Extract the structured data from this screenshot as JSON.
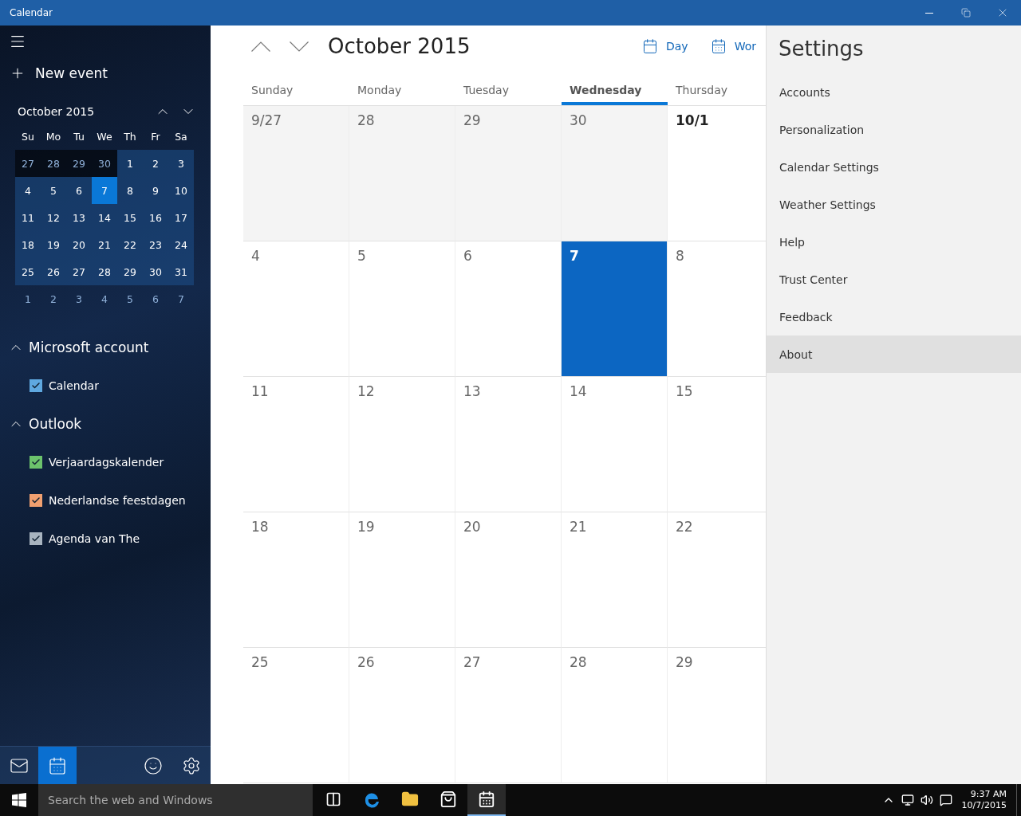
{
  "window": {
    "title": "Calendar"
  },
  "sidebar": {
    "new_event": "New event",
    "mini_calendar": {
      "title": "October 2015",
      "weekdays": [
        "Su",
        "Mo",
        "Tu",
        "We",
        "Th",
        "Fr",
        "Sa"
      ],
      "weeks": [
        [
          {
            "label": "27",
            "kind": "prev"
          },
          {
            "label": "28",
            "kind": "prev"
          },
          {
            "label": "29",
            "kind": "prev"
          },
          {
            "label": "30",
            "kind": "prev"
          },
          {
            "label": "1",
            "kind": "day"
          },
          {
            "label": "2",
            "kind": "day"
          },
          {
            "label": "3",
            "kind": "day"
          }
        ],
        [
          {
            "label": "4",
            "kind": "day"
          },
          {
            "label": "5",
            "kind": "day"
          },
          {
            "label": "6",
            "kind": "day"
          },
          {
            "label": "7",
            "kind": "today"
          },
          {
            "label": "8",
            "kind": "day"
          },
          {
            "label": "9",
            "kind": "day"
          },
          {
            "label": "10",
            "kind": "day"
          }
        ],
        [
          {
            "label": "11",
            "kind": "day"
          },
          {
            "label": "12",
            "kind": "day"
          },
          {
            "label": "13",
            "kind": "day"
          },
          {
            "label": "14",
            "kind": "day"
          },
          {
            "label": "15",
            "kind": "day"
          },
          {
            "label": "16",
            "kind": "day"
          },
          {
            "label": "17",
            "kind": "day"
          }
        ],
        [
          {
            "label": "18",
            "kind": "day"
          },
          {
            "label": "19",
            "kind": "day"
          },
          {
            "label": "20",
            "kind": "day"
          },
          {
            "label": "21",
            "kind": "day"
          },
          {
            "label": "22",
            "kind": "day"
          },
          {
            "label": "23",
            "kind": "day"
          },
          {
            "label": "24",
            "kind": "day"
          }
        ],
        [
          {
            "label": "25",
            "kind": "day"
          },
          {
            "label": "26",
            "kind": "day"
          },
          {
            "label": "27",
            "kind": "day"
          },
          {
            "label": "28",
            "kind": "day"
          },
          {
            "label": "29",
            "kind": "day"
          },
          {
            "label": "30",
            "kind": "day"
          },
          {
            "label": "31",
            "kind": "day"
          }
        ],
        [
          {
            "label": "1",
            "kind": "next"
          },
          {
            "label": "2",
            "kind": "next"
          },
          {
            "label": "3",
            "kind": "next"
          },
          {
            "label": "4",
            "kind": "next"
          },
          {
            "label": "5",
            "kind": "next"
          },
          {
            "label": "6",
            "kind": "next"
          },
          {
            "label": "7",
            "kind": "next"
          }
        ]
      ]
    },
    "accounts": [
      {
        "name": "Microsoft account",
        "expanded": true,
        "calendars": [
          {
            "name": "Calendar",
            "checked": true,
            "color": "#5fa8e0"
          }
        ]
      },
      {
        "name": "Outlook",
        "expanded": true,
        "calendars": [
          {
            "name": "Verjaardagskalender",
            "checked": true,
            "color": "#6cc36c"
          },
          {
            "name": "Nederlandse feestdagen",
            "checked": true,
            "color": "#f0a070"
          },
          {
            "name": "Agenda van The",
            "checked": true,
            "color": "#a8b4c0"
          }
        ]
      }
    ],
    "bottom_nav": [
      {
        "kind": "mail",
        "selected": false
      },
      {
        "kind": "calendar",
        "selected": true
      },
      {
        "kind": "feedback",
        "selected": false
      },
      {
        "kind": "settings",
        "selected": false
      }
    ]
  },
  "main": {
    "title": "October 2015",
    "views": [
      "Day",
      "Wor"
    ],
    "weekdays": [
      {
        "label": "Sunday",
        "selected": false
      },
      {
        "label": "Monday",
        "selected": false
      },
      {
        "label": "Tuesday",
        "selected": false
      },
      {
        "label": "Wednesday",
        "selected": true
      },
      {
        "label": "Thursday",
        "selected": false
      }
    ],
    "weeks": [
      [
        {
          "label": "9/27",
          "kind": "prev"
        },
        {
          "label": "28",
          "kind": "prev"
        },
        {
          "label": "29",
          "kind": "prev"
        },
        {
          "label": "30",
          "kind": "prev"
        },
        {
          "label": "10/1",
          "kind": "first"
        }
      ],
      [
        {
          "label": "4",
          "kind": "day"
        },
        {
          "label": "5",
          "kind": "day"
        },
        {
          "label": "6",
          "kind": "day"
        },
        {
          "label": "7",
          "kind": "today"
        },
        {
          "label": "8",
          "kind": "day"
        }
      ],
      [
        {
          "label": "11",
          "kind": "day"
        },
        {
          "label": "12",
          "kind": "day"
        },
        {
          "label": "13",
          "kind": "day"
        },
        {
          "label": "14",
          "kind": "day"
        },
        {
          "label": "15",
          "kind": "day"
        }
      ],
      [
        {
          "label": "18",
          "kind": "day"
        },
        {
          "label": "19",
          "kind": "day"
        },
        {
          "label": "20",
          "kind": "day"
        },
        {
          "label": "21",
          "kind": "day"
        },
        {
          "label": "22",
          "kind": "day"
        }
      ],
      [
        {
          "label": "25",
          "kind": "day"
        },
        {
          "label": "26",
          "kind": "day"
        },
        {
          "label": "27",
          "kind": "day"
        },
        {
          "label": "28",
          "kind": "day"
        },
        {
          "label": "29",
          "kind": "day"
        }
      ]
    ]
  },
  "settings": {
    "title": "Settings",
    "items": [
      {
        "label": "Accounts",
        "selected": false
      },
      {
        "label": "Personalization",
        "selected": false
      },
      {
        "label": "Calendar Settings",
        "selected": false
      },
      {
        "label": "Weather Settings",
        "selected": false
      },
      {
        "label": "Help",
        "selected": false
      },
      {
        "label": "Trust Center",
        "selected": false
      },
      {
        "label": "Feedback",
        "selected": false
      },
      {
        "label": "About",
        "selected": true
      }
    ]
  },
  "taskbar": {
    "search": {
      "placeholder": "Search the web and Windows"
    },
    "apps": [
      {
        "kind": "taskview",
        "active": false
      },
      {
        "kind": "edge",
        "active": false
      },
      {
        "kind": "explorer",
        "active": false
      },
      {
        "kind": "store",
        "active": false
      },
      {
        "kind": "calendar",
        "active": true
      }
    ],
    "time": "9:37 AM",
    "date": "10/7/2015"
  }
}
